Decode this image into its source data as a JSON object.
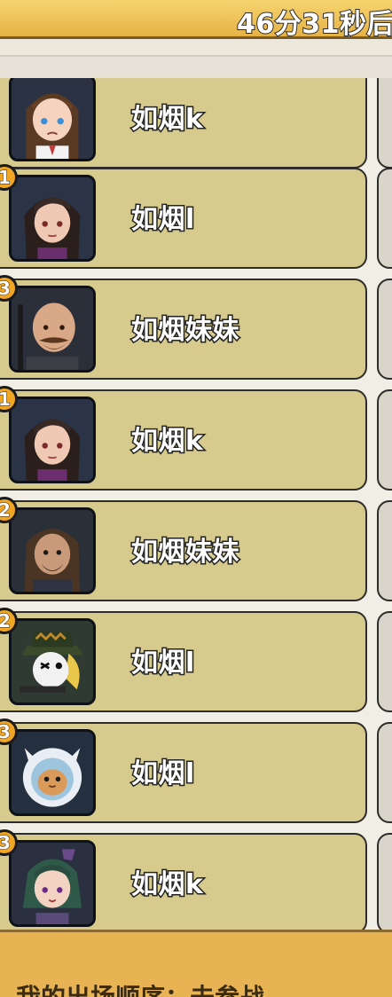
{
  "header": {
    "timer": "46分31秒后"
  },
  "rows": [
    {
      "rank": "",
      "name": "如烟k",
      "avatar": "anime-girl-brown-hair-avatar"
    },
    {
      "rank": "1",
      "name": "如烟l",
      "avatar": "dark-hair-woman-avatar"
    },
    {
      "rank": "3",
      "name": "如烟妹妹",
      "avatar": "bald-bearded-man-avatar"
    },
    {
      "rank": "1",
      "name": "如烟k",
      "avatar": "dark-hair-woman-avatar"
    },
    {
      "rank": "2",
      "name": "如烟妹妹",
      "avatar": "long-hair-soldier-avatar"
    },
    {
      "rank": "2",
      "name": "如烟l",
      "avatar": "masked-sniper-avatar"
    },
    {
      "rank": "3",
      "name": "如烟l",
      "avatar": "cat-astronaut-avatar"
    },
    {
      "rank": "3",
      "name": "如烟k",
      "avatar": "green-hair-girl-avatar"
    }
  ],
  "footer": {
    "label": "我的出场顺序：未参战"
  },
  "colors": {
    "row_bg": "#d6cb8c",
    "badge": "#f0a623",
    "header": "#e6b246",
    "footer": "#e8b453"
  }
}
